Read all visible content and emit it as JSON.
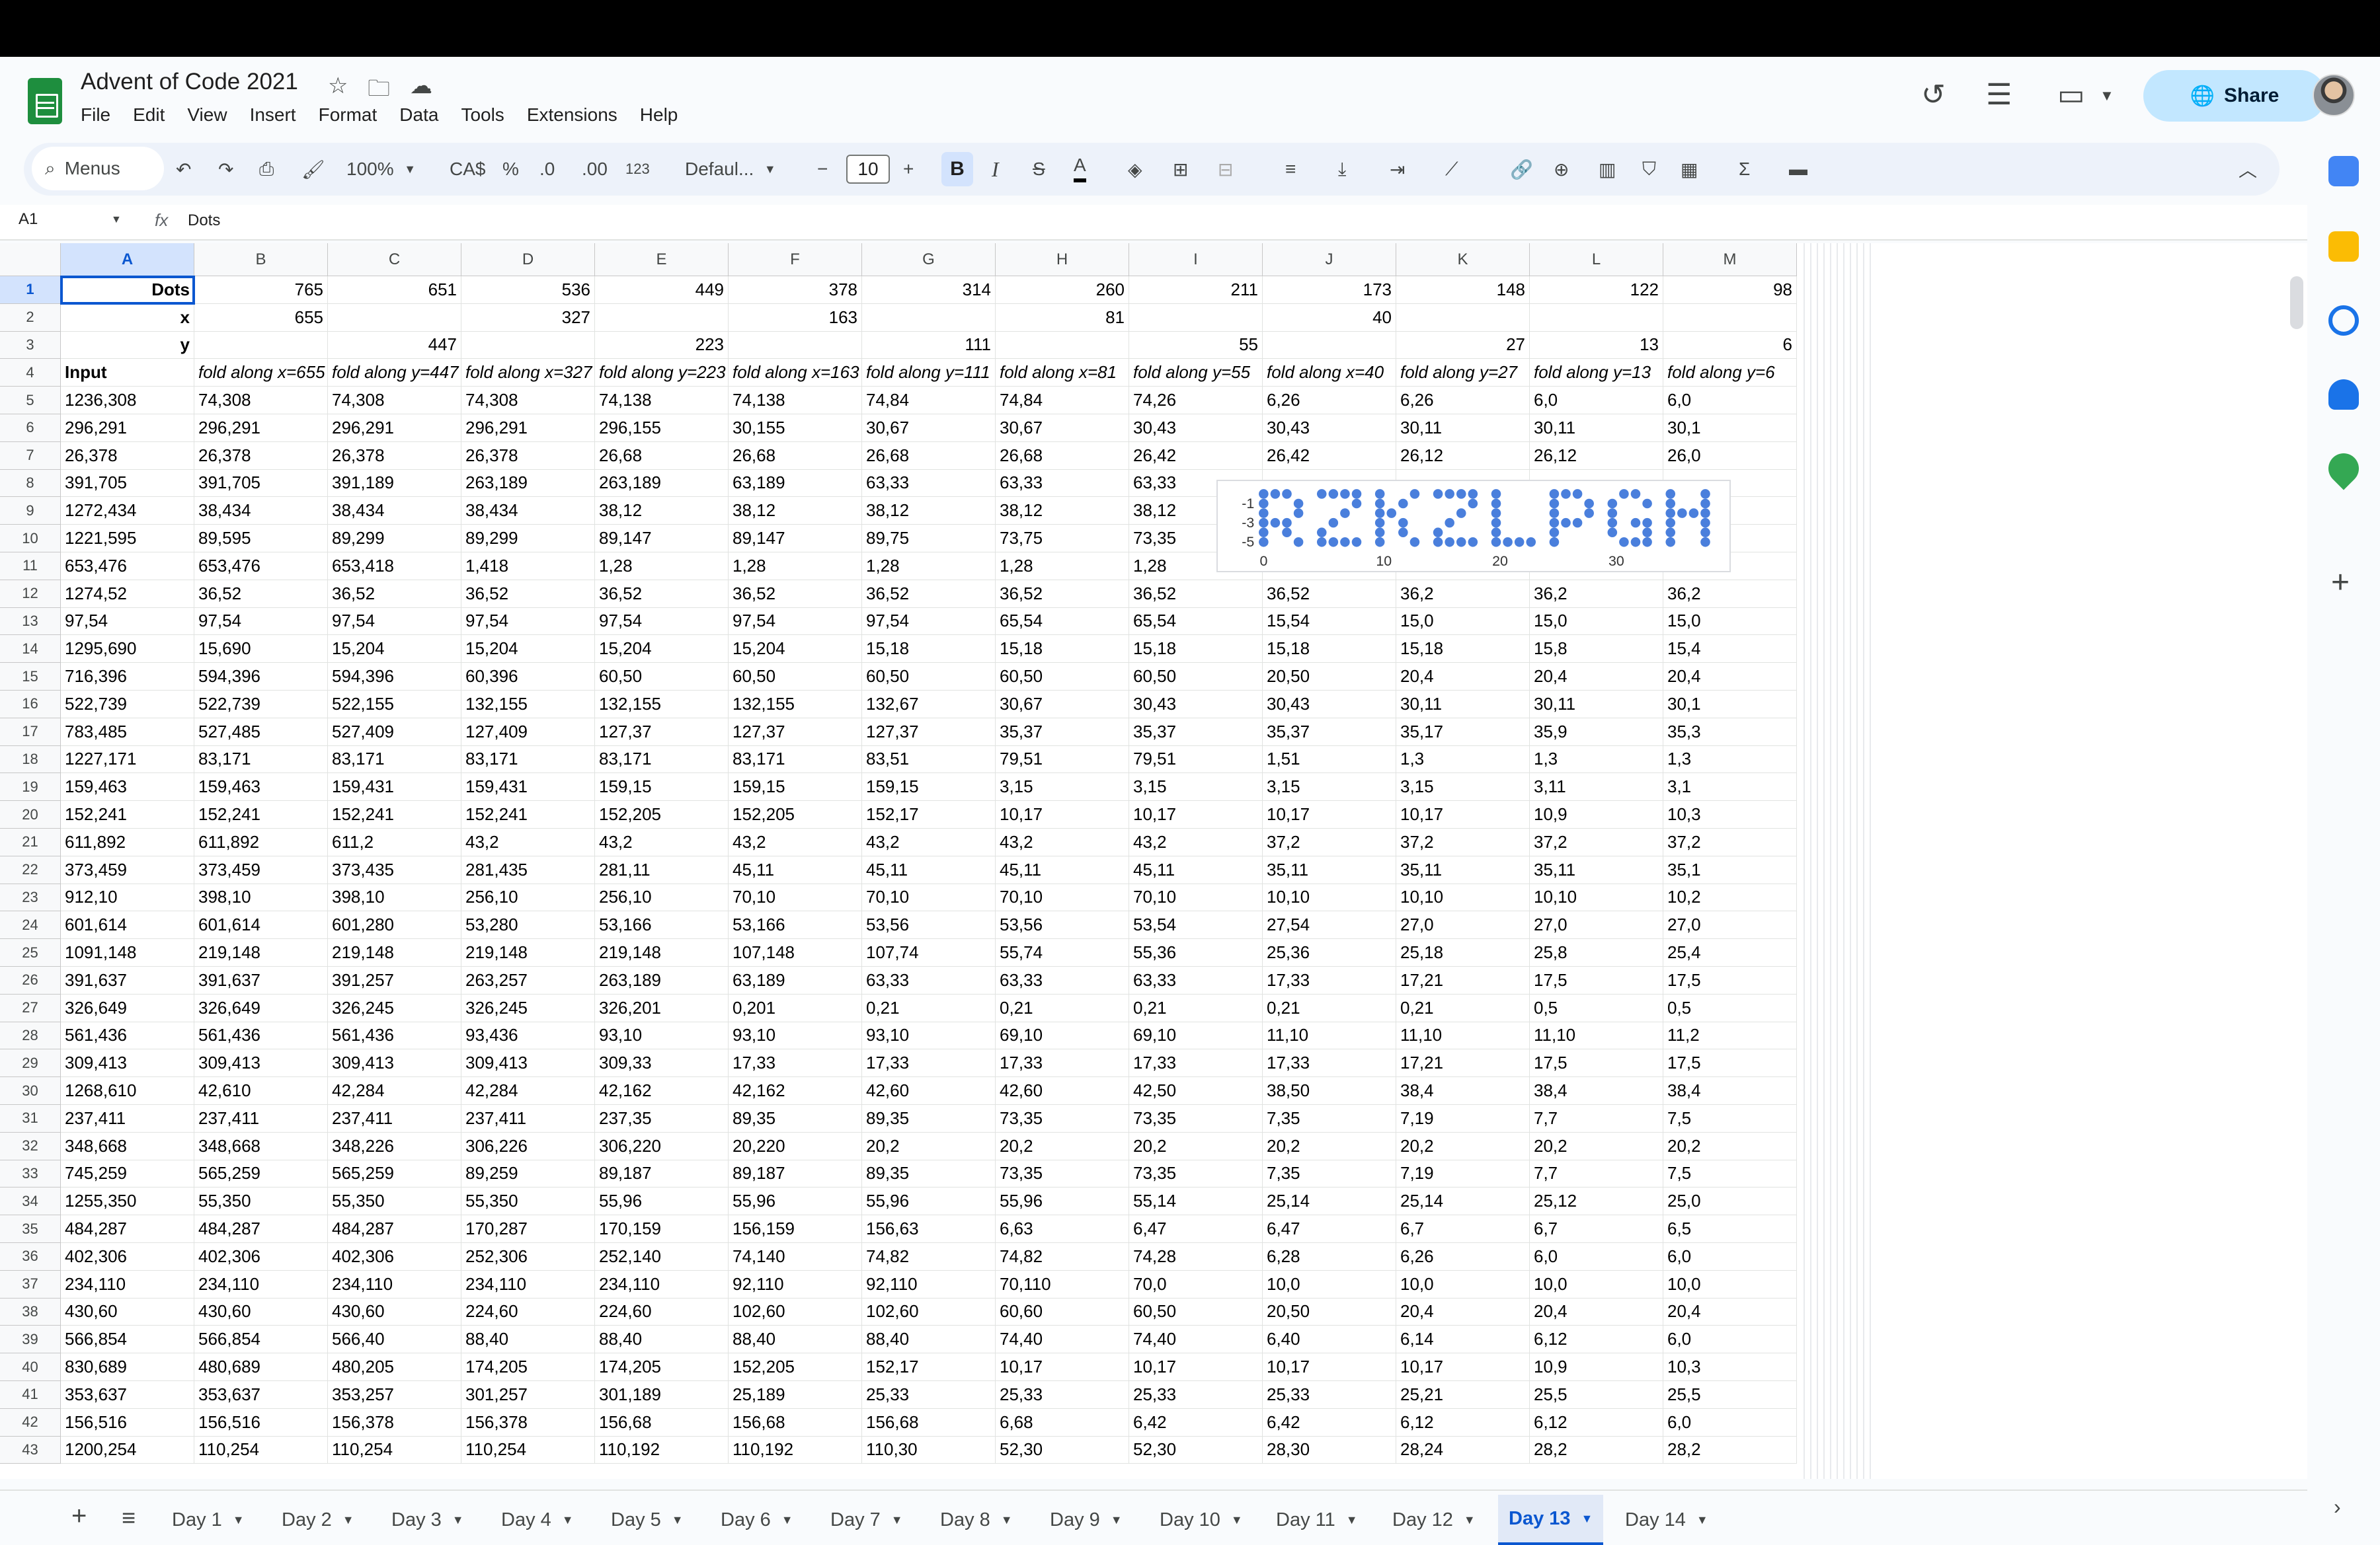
{
  "app": {
    "doc_title": "Advent of Code 2021",
    "menus": [
      "File",
      "Edit",
      "View",
      "Insert",
      "Format",
      "Data",
      "Tools",
      "Extensions",
      "Help"
    ],
    "share_label": "Share"
  },
  "toolbar": {
    "search_label": "Menus",
    "zoom": "100%",
    "currency": "CA$",
    "percent": "%",
    "dec_decrease": ".0",
    "dec_increase": ".00",
    "format_num": "123",
    "font": "Defaul...",
    "font_size": "10"
  },
  "formula_bar": {
    "name_box": "A1",
    "fx": "fx",
    "value": "Dots"
  },
  "columns": [
    "A",
    "B",
    "C",
    "D",
    "E",
    "F",
    "G",
    "H",
    "I",
    "J",
    "K",
    "L",
    "M"
  ],
  "rows": [
    [
      "Dots",
      "765",
      "651",
      "536",
      "449",
      "378",
      "314",
      "260",
      "211",
      "173",
      "148",
      "122",
      "98"
    ],
    [
      "x",
      "655",
      "",
      "327",
      "",
      "163",
      "",
      "81",
      "",
      "40",
      "",
      "",
      ""
    ],
    [
      "y",
      "",
      "447",
      "",
      "223",
      "",
      "111",
      "",
      "55",
      "",
      "27",
      "13",
      "6"
    ],
    [
      "Input",
      "fold along x=655",
      "fold along y=447",
      "fold along x=327",
      "fold along y=223",
      "fold along x=163",
      "fold along y=111",
      "fold along x=81",
      "fold along y=55",
      "fold along x=40",
      "fold along y=27",
      "fold along y=13",
      "fold along y=6"
    ],
    [
      "1236,308",
      "74,308",
      "74,308",
      "74,308",
      "74,138",
      "74,138",
      "74,84",
      "74,84",
      "74,26",
      "6,26",
      "6,26",
      "6,0",
      "6,0"
    ],
    [
      "296,291",
      "296,291",
      "296,291",
      "296,291",
      "296,155",
      "30,155",
      "30,67",
      "30,67",
      "30,43",
      "30,43",
      "30,11",
      "30,11",
      "30,1"
    ],
    [
      "26,378",
      "26,378",
      "26,378",
      "26,378",
      "26,68",
      "26,68",
      "26,68",
      "26,68",
      "26,42",
      "26,42",
      "26,12",
      "26,12",
      "26,0"
    ],
    [
      "391,705",
      "391,705",
      "391,189",
      "263,189",
      "263,189",
      "63,189",
      "63,33",
      "63,33",
      "63,33",
      "",
      "",
      "",
      ""
    ],
    [
      "1272,434",
      "38,434",
      "38,434",
      "38,434",
      "38,12",
      "38,12",
      "38,12",
      "38,12",
      "38,12",
      "",
      "",
      "",
      ""
    ],
    [
      "1221,595",
      "89,595",
      "89,299",
      "89,299",
      "89,147",
      "89,147",
      "89,75",
      "73,75",
      "73,35",
      "",
      "",
      "",
      ""
    ],
    [
      "653,476",
      "653,476",
      "653,418",
      "1,418",
      "1,28",
      "1,28",
      "1,28",
      "1,28",
      "1,28",
      "",
      "",
      "",
      ""
    ],
    [
      "1274,52",
      "36,52",
      "36,52",
      "36,52",
      "36,52",
      "36,52",
      "36,52",
      "36,52",
      "36,52",
      "36,52",
      "36,2",
      "36,2",
      "36,2"
    ],
    [
      "97,54",
      "97,54",
      "97,54",
      "97,54",
      "97,54",
      "97,54",
      "97,54",
      "65,54",
      "65,54",
      "15,54",
      "15,0",
      "15,0",
      "15,0"
    ],
    [
      "1295,690",
      "15,690",
      "15,204",
      "15,204",
      "15,204",
      "15,204",
      "15,18",
      "15,18",
      "15,18",
      "15,18",
      "15,18",
      "15,8",
      "15,4"
    ],
    [
      "716,396",
      "594,396",
      "594,396",
      "60,396",
      "60,50",
      "60,50",
      "60,50",
      "60,50",
      "60,50",
      "20,50",
      "20,4",
      "20,4",
      "20,4"
    ],
    [
      "522,739",
      "522,739",
      "522,155",
      "132,155",
      "132,155",
      "132,155",
      "132,67",
      "30,67",
      "30,43",
      "30,43",
      "30,11",
      "30,11",
      "30,1"
    ],
    [
      "783,485",
      "527,485",
      "527,409",
      "127,409",
      "127,37",
      "127,37",
      "127,37",
      "35,37",
      "35,37",
      "35,37",
      "35,17",
      "35,9",
      "35,3"
    ],
    [
      "1227,171",
      "83,171",
      "83,171",
      "83,171",
      "83,171",
      "83,171",
      "83,51",
      "79,51",
      "79,51",
      "1,51",
      "1,3",
      "1,3",
      "1,3"
    ],
    [
      "159,463",
      "159,463",
      "159,431",
      "159,431",
      "159,15",
      "159,15",
      "159,15",
      "3,15",
      "3,15",
      "3,15",
      "3,15",
      "3,11",
      "3,1"
    ],
    [
      "152,241",
      "152,241",
      "152,241",
      "152,241",
      "152,205",
      "152,205",
      "152,17",
      "10,17",
      "10,17",
      "10,17",
      "10,17",
      "10,9",
      "10,3"
    ],
    [
      "611,892",
      "611,892",
      "611,2",
      "43,2",
      "43,2",
      "43,2",
      "43,2",
      "43,2",
      "43,2",
      "37,2",
      "37,2",
      "37,2",
      "37,2"
    ],
    [
      "373,459",
      "373,459",
      "373,435",
      "281,435",
      "281,11",
      "45,11",
      "45,11",
      "45,11",
      "45,11",
      "35,11",
      "35,11",
      "35,11",
      "35,1"
    ],
    [
      "912,10",
      "398,10",
      "398,10",
      "256,10",
      "256,10",
      "70,10",
      "70,10",
      "70,10",
      "70,10",
      "10,10",
      "10,10",
      "10,10",
      "10,2"
    ],
    [
      "601,614",
      "601,614",
      "601,280",
      "53,280",
      "53,166",
      "53,166",
      "53,56",
      "53,56",
      "53,54",
      "27,54",
      "27,0",
      "27,0",
      "27,0"
    ],
    [
      "1091,148",
      "219,148",
      "219,148",
      "219,148",
      "219,148",
      "107,148",
      "107,74",
      "55,74",
      "55,36",
      "25,36",
      "25,18",
      "25,8",
      "25,4"
    ],
    [
      "391,637",
      "391,637",
      "391,257",
      "263,257",
      "263,189",
      "63,189",
      "63,33",
      "63,33",
      "63,33",
      "17,33",
      "17,21",
      "17,5",
      "17,5"
    ],
    [
      "326,649",
      "326,649",
      "326,245",
      "326,245",
      "326,201",
      "0,201",
      "0,21",
      "0,21",
      "0,21",
      "0,21",
      "0,21",
      "0,5",
      "0,5"
    ],
    [
      "561,436",
      "561,436",
      "561,436",
      "93,436",
      "93,10",
      "93,10",
      "93,10",
      "69,10",
      "69,10",
      "11,10",
      "11,10",
      "11,10",
      "11,2"
    ],
    [
      "309,413",
      "309,413",
      "309,413",
      "309,413",
      "309,33",
      "17,33",
      "17,33",
      "17,33",
      "17,33",
      "17,33",
      "17,21",
      "17,5",
      "17,5"
    ],
    [
      "1268,610",
      "42,610",
      "42,284",
      "42,284",
      "42,162",
      "42,162",
      "42,60",
      "42,60",
      "42,50",
      "38,50",
      "38,4",
      "38,4",
      "38,4"
    ],
    [
      "237,411",
      "237,411",
      "237,411",
      "237,411",
      "237,35",
      "89,35",
      "89,35",
      "73,35",
      "73,35",
      "7,35",
      "7,19",
      "7,7",
      "7,5"
    ],
    [
      "348,668",
      "348,668",
      "348,226",
      "306,226",
      "306,220",
      "20,220",
      "20,2",
      "20,2",
      "20,2",
      "20,2",
      "20,2",
      "20,2",
      "20,2"
    ],
    [
      "745,259",
      "565,259",
      "565,259",
      "89,259",
      "89,187",
      "89,187",
      "89,35",
      "73,35",
      "73,35",
      "7,35",
      "7,19",
      "7,7",
      "7,5"
    ],
    [
      "1255,350",
      "55,350",
      "55,350",
      "55,350",
      "55,96",
      "55,96",
      "55,96",
      "55,96",
      "55,14",
      "25,14",
      "25,14",
      "25,12",
      "25,0"
    ],
    [
      "484,287",
      "484,287",
      "484,287",
      "170,287",
      "170,159",
      "156,159",
      "156,63",
      "6,63",
      "6,47",
      "6,47",
      "6,7",
      "6,7",
      "6,5"
    ],
    [
      "402,306",
      "402,306",
      "402,306",
      "252,306",
      "252,140",
      "74,140",
      "74,82",
      "74,82",
      "74,28",
      "6,28",
      "6,26",
      "6,0",
      "6,0"
    ],
    [
      "234,110",
      "234,110",
      "234,110",
      "234,110",
      "234,110",
      "92,110",
      "92,110",
      "70,110",
      "70,0",
      "10,0",
      "10,0",
      "10,0",
      "10,0"
    ],
    [
      "430,60",
      "430,60",
      "430,60",
      "224,60",
      "224,60",
      "102,60",
      "102,60",
      "60,60",
      "60,50",
      "20,50",
      "20,4",
      "20,4",
      "20,4"
    ],
    [
      "566,854",
      "566,854",
      "566,40",
      "88,40",
      "88,40",
      "88,40",
      "88,40",
      "74,40",
      "74,40",
      "6,40",
      "6,14",
      "6,12",
      "6,0"
    ],
    [
      "830,689",
      "480,689",
      "480,205",
      "174,205",
      "174,205",
      "152,205",
      "152,17",
      "10,17",
      "10,17",
      "10,17",
      "10,17",
      "10,9",
      "10,3"
    ],
    [
      "353,637",
      "353,637",
      "353,257",
      "301,257",
      "301,189",
      "25,189",
      "25,33",
      "25,33",
      "25,33",
      "25,33",
      "25,21",
      "25,5",
      "25,5"
    ],
    [
      "156,516",
      "156,516",
      "156,378",
      "156,378",
      "156,68",
      "156,68",
      "156,68",
      "6,68",
      "6,42",
      "6,42",
      "6,12",
      "6,12",
      "6,0"
    ],
    [
      "1200,254",
      "110,254",
      "110,254",
      "110,254",
      "110,192",
      "110,192",
      "110,30",
      "52,30",
      "52,30",
      "28,30",
      "28,24",
      "28,2",
      "28,2"
    ]
  ],
  "chart": {
    "y_ticks": [
      "-1",
      "-3",
      "-5"
    ],
    "x_ticks": [
      "0",
      "10",
      "20",
      "30"
    ],
    "color": "#4a7fdc"
  },
  "tabs": [
    "Day 1",
    "Day 2",
    "Day 3",
    "Day 4",
    "Day 5",
    "Day 6",
    "Day 7",
    "Day 8",
    "Day 9",
    "Day 10",
    "Day 11",
    "Day 12",
    "Day 13",
    "Day 14"
  ],
  "active_tab": "Day 13"
}
